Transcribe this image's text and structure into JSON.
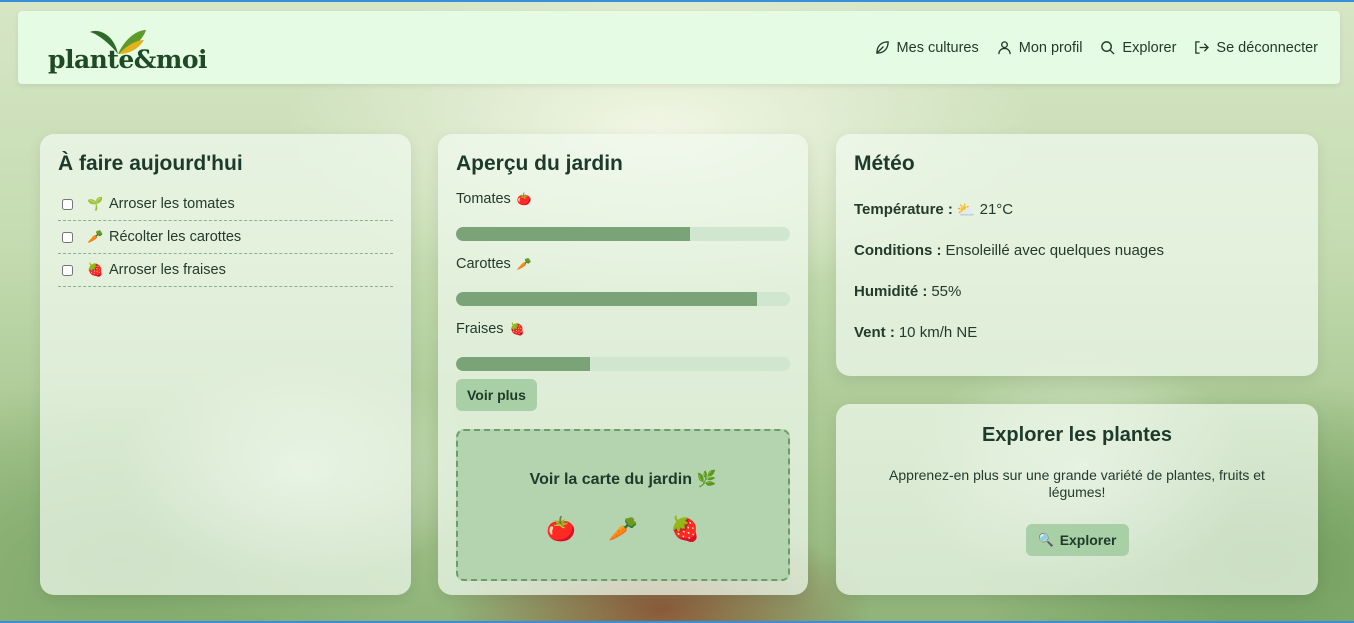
{
  "nav": {
    "logo": "plante&moi",
    "links": [
      {
        "label": "Mes cultures",
        "icon": "leaf-icon"
      },
      {
        "label": "Mon profil",
        "icon": "user-icon"
      },
      {
        "label": "Explorer",
        "icon": "search-icon"
      },
      {
        "label": "Se déconnecter",
        "icon": "logout-icon"
      }
    ]
  },
  "todo": {
    "title": "À faire aujourd'hui",
    "items": [
      {
        "emoji": "🌱",
        "label": "Arroser les tomates",
        "checked": false
      },
      {
        "emoji": "🥕",
        "label": "Récolter les carottes",
        "checked": false
      },
      {
        "emoji": "🍓",
        "label": "Arroser les fraises",
        "checked": false
      }
    ]
  },
  "garden": {
    "title": "Aperçu du jardin",
    "plants": [
      {
        "label": "Tomates",
        "emoji": "🍅",
        "progress": 0.7
      },
      {
        "label": "Carottes",
        "emoji": "🥕",
        "progress": 0.9
      },
      {
        "label": "Fraises",
        "emoji": "🍓",
        "progress": 0.4
      }
    ],
    "more_label": "Voir plus",
    "map_title": "Voir la carte du jardin 🌿",
    "map_icons": [
      "🍅",
      "🥕",
      "🍓"
    ]
  },
  "meteo": {
    "title": "Météo",
    "temperature_label": "Température :",
    "temperature_emoji": "⛅",
    "temperature_value": "21°C",
    "conditions_label": "Conditions :",
    "conditions_value": "Ensoleillé avec quelques nuages",
    "humidity_label": "Humidité :",
    "humidity_value": "55%",
    "wind_label": "Vent :",
    "wind_value": "10 km/h NE"
  },
  "explore": {
    "title": "Explorer les plantes",
    "description": "Apprenez-en plus sur une grande variété de plantes, fruits et légumes!",
    "button_emoji": "🔍",
    "button_label": "Explorer"
  },
  "colors": {
    "accent": "#7aa378",
    "button": "#a9cfa6",
    "nav_bg": "#e6fbe4"
  }
}
